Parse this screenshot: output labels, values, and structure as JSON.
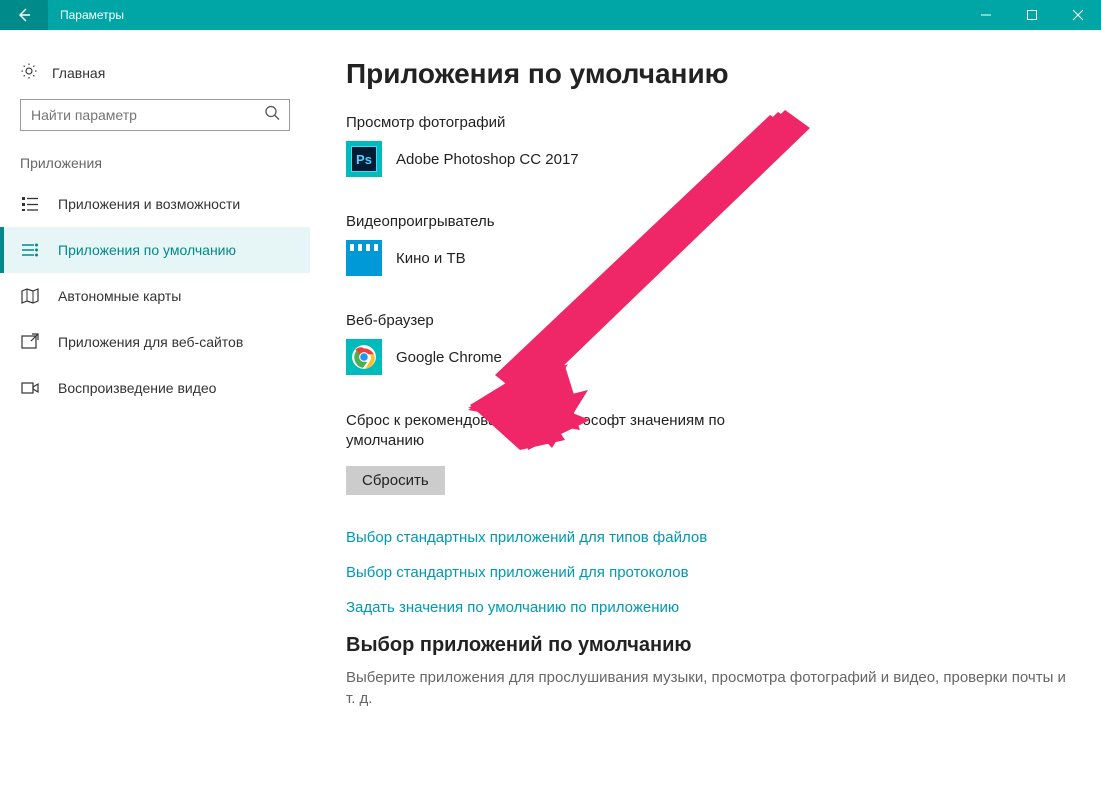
{
  "window": {
    "title": "Параметры"
  },
  "sidebar": {
    "home": "Главная",
    "search_placeholder": "Найти параметр",
    "group": "Приложения",
    "items": [
      {
        "label": "Приложения и возможности"
      },
      {
        "label": "Приложения по умолчанию"
      },
      {
        "label": "Автономные карты"
      },
      {
        "label": "Приложения для веб-сайтов"
      },
      {
        "label": "Воспроизведение видео"
      }
    ],
    "active_index": 1
  },
  "main": {
    "title": "Приложения по умолчанию",
    "sections": [
      {
        "label": "Просмотр фотографий",
        "app": "Adobe Photoshop CC 2017",
        "icon": "photoshop"
      },
      {
        "label": "Видеопроигрыватель",
        "app": "Кино и ТВ",
        "icon": "movies-tv"
      },
      {
        "label": "Веб-браузер",
        "app": "Google Chrome",
        "icon": "chrome"
      }
    ],
    "reset_text": "Сброс к рекомендованным Майкрософт значениям по умолчанию",
    "reset_button": "Сбросить",
    "links": [
      "Выбор стандартных приложений для типов файлов",
      "Выбор стандартных приложений для протоколов",
      "Задать значения по умолчанию по приложению"
    ],
    "subheading": "Выбор приложений по умолчанию",
    "subtext": "Выберите приложения для прослушивания музыки, просмотра фотографий и видео, проверки почты и т. д."
  },
  "annotation": {
    "arrow_color": "#ef2667"
  }
}
